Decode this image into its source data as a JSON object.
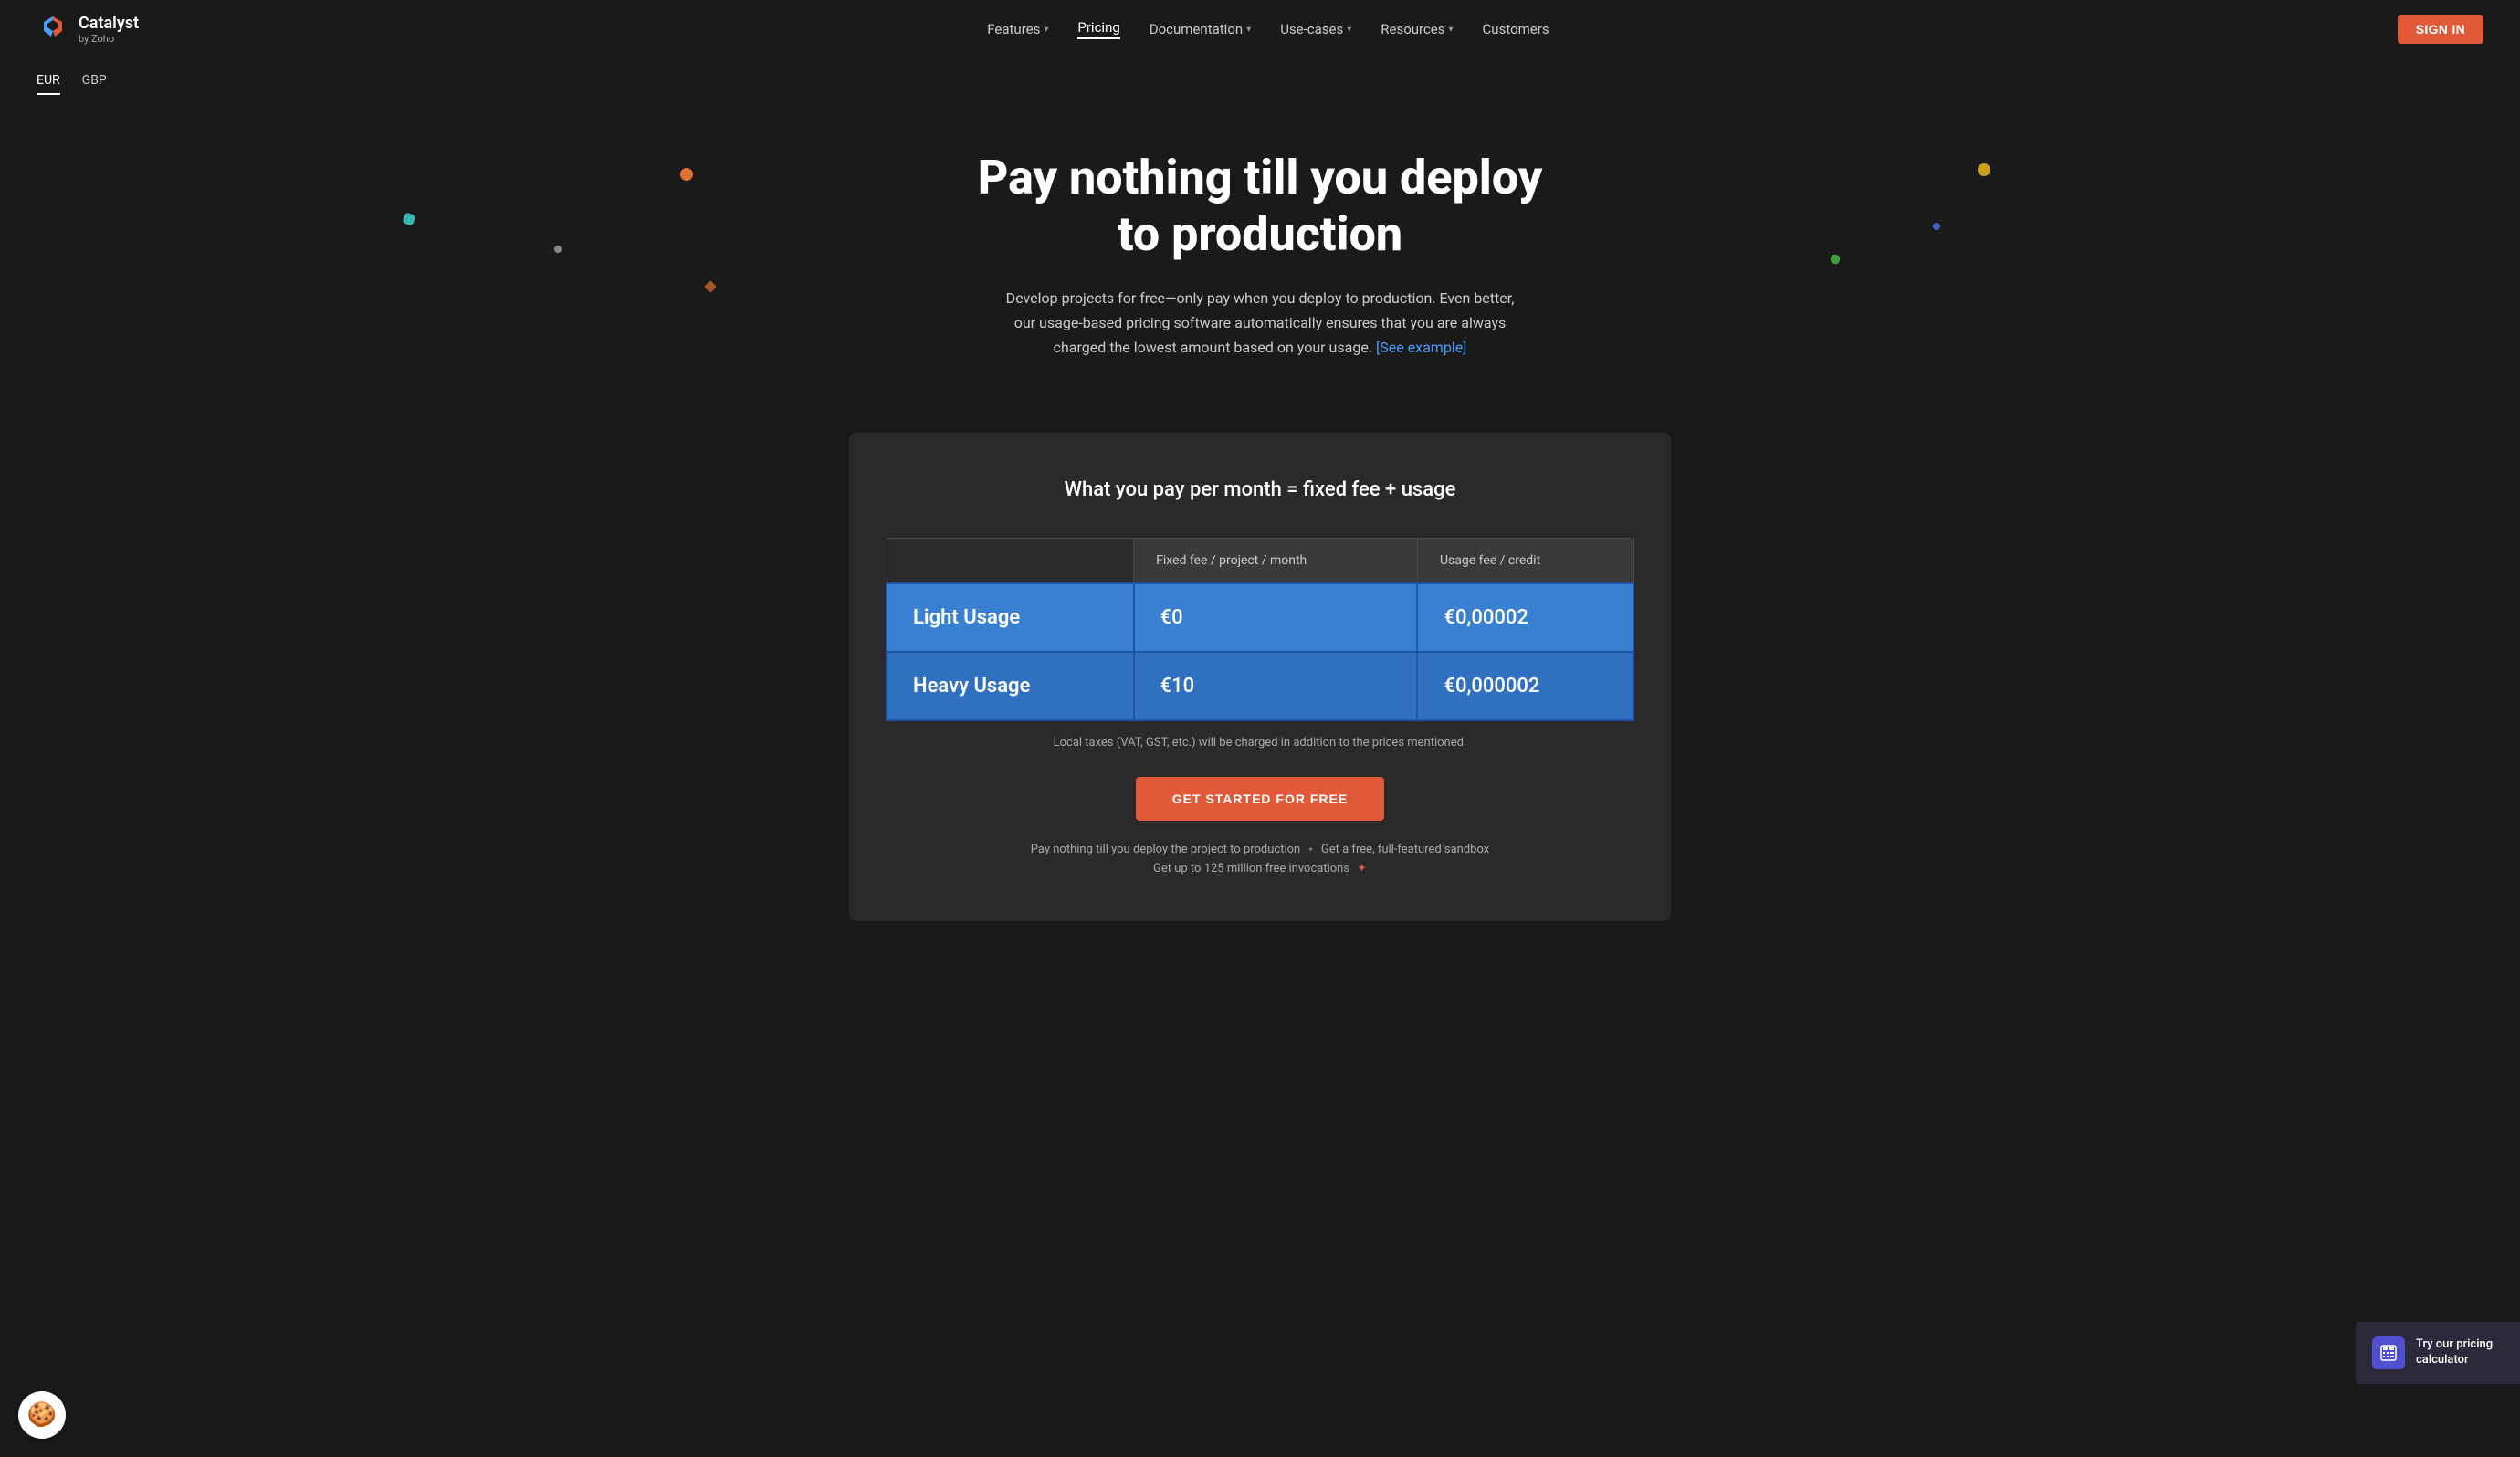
{
  "nav": {
    "logo_title": "Catalyst",
    "logo_subtitle": "by Zoho",
    "links": [
      {
        "label": "Features",
        "has_dropdown": true,
        "active": false
      },
      {
        "label": "Pricing",
        "has_dropdown": false,
        "active": true
      },
      {
        "label": "Documentation",
        "has_dropdown": true,
        "active": false
      },
      {
        "label": "Use-cases",
        "has_dropdown": true,
        "active": false
      },
      {
        "label": "Resources",
        "has_dropdown": true,
        "active": false
      },
      {
        "label": "Customers",
        "has_dropdown": false,
        "active": false
      }
    ],
    "signin_label": "SIGN IN"
  },
  "currency": {
    "tabs": [
      "EUR",
      "GBP"
    ],
    "active": "EUR"
  },
  "hero": {
    "heading_line1": "Pay nothing till you deploy",
    "heading_line2": "to production",
    "description": "Develop projects for free—only pay when you deploy to production. Even better, our usage-based pricing software automatically ensures that you are always charged the lowest amount based on your usage.",
    "see_example_label": "[See example]",
    "see_example_url": "#"
  },
  "pricing": {
    "section_heading": "What you pay per month = fixed fee + usage",
    "table": {
      "col_headers": [
        "",
        "Fixed fee / project / month",
        "Usage fee / credit"
      ],
      "rows": [
        {
          "plan": "Light Usage",
          "fixed_fee": "€0",
          "usage_fee": "€0,00002",
          "row_class": "light-row"
        },
        {
          "plan": "Heavy Usage",
          "fixed_fee": "€10",
          "usage_fee": "€0,000002",
          "row_class": "heavy-row"
        }
      ]
    },
    "tax_note": "Local taxes (VAT, GST, etc.) will be charged in addition to the prices mentioned.",
    "cta_label": "GET STARTED FOR FREE",
    "bottom_notes": [
      "Pay nothing till you deploy the project to production  ✦  Get a free, full-featured sandbox",
      "Get up to 125 million free invocations ✦"
    ]
  },
  "pricing_calc_widget": {
    "label": "Try our pricing calculator"
  },
  "cookie_widget": {
    "emoji": "🍪"
  }
}
